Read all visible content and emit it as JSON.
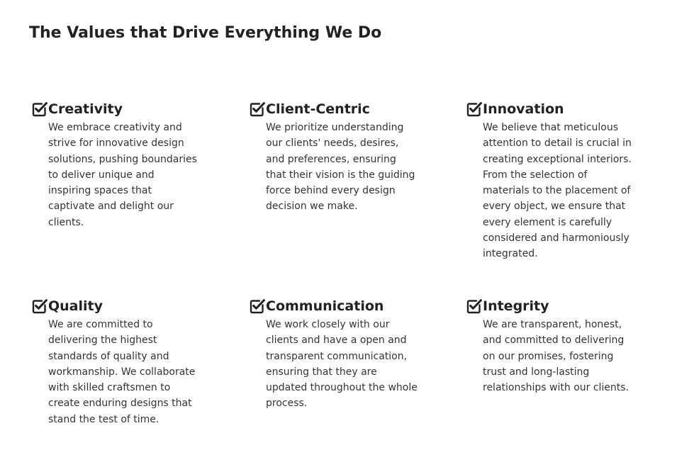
{
  "page": {
    "title": "The Values that Drive Everything We Do"
  },
  "icon": {
    "name": "check-square-icon",
    "color": "#222222"
  },
  "values": [
    {
      "title": "Creativity",
      "text": "We embrace creativity and strive for innovative design solutions, pushing boundaries to deliver unique and inspiring spaces that captivate and delight our clients."
    },
    {
      "title": "Client-Centric",
      "text": "We prioritize understanding our clients' needs, desires, and preferences, ensuring that their vision is the guiding force behind every design decision we make."
    },
    {
      "title": "Innovation",
      "text": "We believe that meticulous attention to detail is crucial in creating exceptional interiors. From the selection of materials to the placement of every object, we ensure that every element is carefully considered and harmoniously integrated."
    },
    {
      "title": "Quality",
      "text": "We are committed to delivering the highest standards of quality and workmanship. We collaborate with skilled craftsmen to create enduring designs that stand the test of time."
    },
    {
      "title": "Communication",
      "text": "We work closely with our clients and have a open and transparent communication, ensuring that they are updated throughout the whole process."
    },
    {
      "title": "Integrity",
      "text": "We are transparent, honest, and committed to delivering on our promises, fostering trust and long-lasting relationships with our clients."
    }
  ]
}
